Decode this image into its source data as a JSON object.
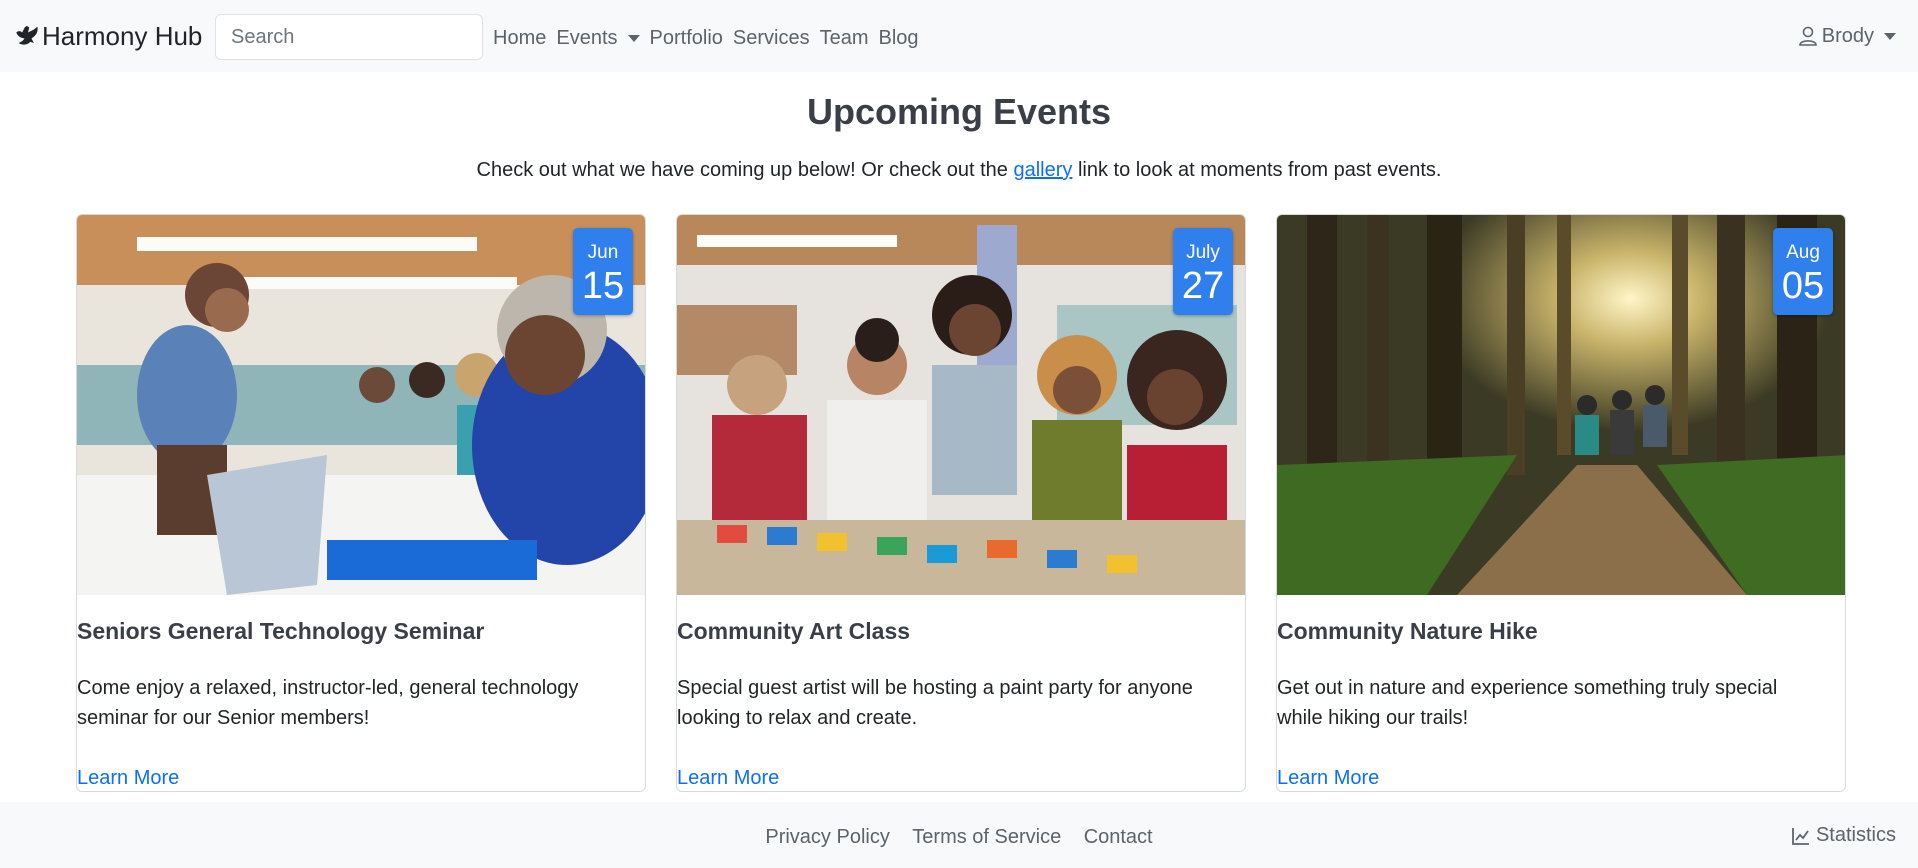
{
  "brand": {
    "name": "Harmony Hub",
    "icon": "dove-icon"
  },
  "search": {
    "placeholder": "Search",
    "value": ""
  },
  "nav": {
    "home": "Home",
    "events": "Events",
    "portfolio": "Portfolio",
    "services": "Services",
    "team": "Team",
    "blog": "Blog"
  },
  "user": {
    "name": "Brody",
    "icon": "person-icon"
  },
  "page": {
    "title": "Upcoming Events",
    "intro_before": "Check out what we have coming up below! Or check out the ",
    "intro_link": "gallery",
    "intro_after": " link to look at moments from past events."
  },
  "events": [
    {
      "month": "Jun",
      "day": "15",
      "title": "Seniors General Technology Seminar",
      "description": "Come enjoy a relaxed, instructor-led, general technology seminar for our Senior members!",
      "link": "Learn More"
    },
    {
      "month": "July",
      "day": "27",
      "title": "Community Art Class",
      "description": "Special guest artist will be hosting a paint party for anyone looking to relax and create.",
      "link": "Learn More"
    },
    {
      "month": "Aug",
      "day": "05",
      "title": "Community Nature Hike",
      "description": "Get out in nature and experience something truly special while hiking our trails!",
      "link": "Learn More"
    }
  ],
  "footer": {
    "privacy": "Privacy Policy",
    "terms": "Terms of Service",
    "contact": "Contact",
    "statistics": "Statistics",
    "statistics_icon": "line-chart-icon"
  },
  "colors": {
    "accent": "#2f80ed",
    "link": "#0d6efd",
    "navbar_bg": "#f8f9fa"
  }
}
